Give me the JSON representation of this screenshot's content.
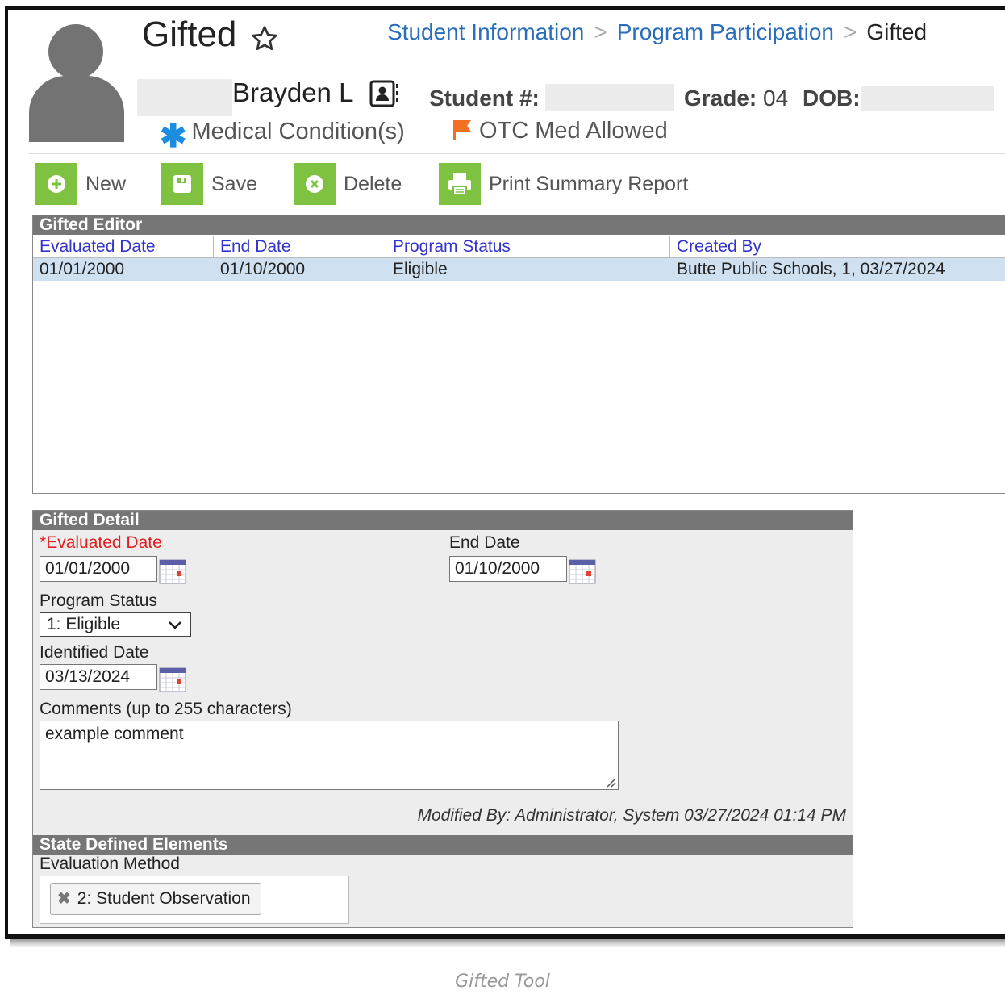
{
  "header": {
    "title": "Gifted",
    "breadcrumb": [
      "Student Information",
      "Program Participation",
      "Gifted"
    ],
    "student_name": "Brayden L",
    "student_number_label": "Student #:",
    "grade_label": "Grade:",
    "grade_value": "04",
    "dob_label": "DOB:",
    "alerts": [
      {
        "label": "Medical Condition(s)",
        "icon": "asterisk-icon",
        "color": "#1a8de0"
      },
      {
        "label": "OTC Med Allowed",
        "icon": "flag-icon",
        "color": "#f36f21"
      }
    ]
  },
  "toolbar": {
    "new_label": "New",
    "save_label": "Save",
    "delete_label": "Delete",
    "print_label": "Print Summary Report",
    "accent": "#7fc241"
  },
  "editor": {
    "title": "Gifted Editor",
    "columns": [
      "Evaluated Date",
      "End Date",
      "Program Status",
      "Created By"
    ],
    "rows": [
      {
        "evaluated_date": "01/01/2000",
        "end_date": "01/10/2000",
        "program_status": "Eligible",
        "created_by": "Butte Public Schools, 1, 03/27/2024"
      }
    ]
  },
  "detail": {
    "title": "Gifted Detail",
    "evaluated_date_required": "*",
    "evaluated_date_label": "Evaluated Date",
    "evaluated_date_value": "01/01/2000",
    "end_date_label": "End Date",
    "end_date_value": "01/10/2000",
    "program_status_label": "Program Status",
    "program_status_value": "1: Eligible",
    "identified_date_label": "Identified Date",
    "identified_date_value": "03/13/2024",
    "comments_label": "Comments (up to 255 characters)",
    "comments_value": "example comment",
    "modified_by": "Modified By: Administrator, System 03/27/2024 01:14 PM"
  },
  "state_elements": {
    "title": "State Defined Elements",
    "evaluation_method_label": "Evaluation Method",
    "evaluation_method_value": "2: Student Observation"
  },
  "caption": "Gifted Tool"
}
